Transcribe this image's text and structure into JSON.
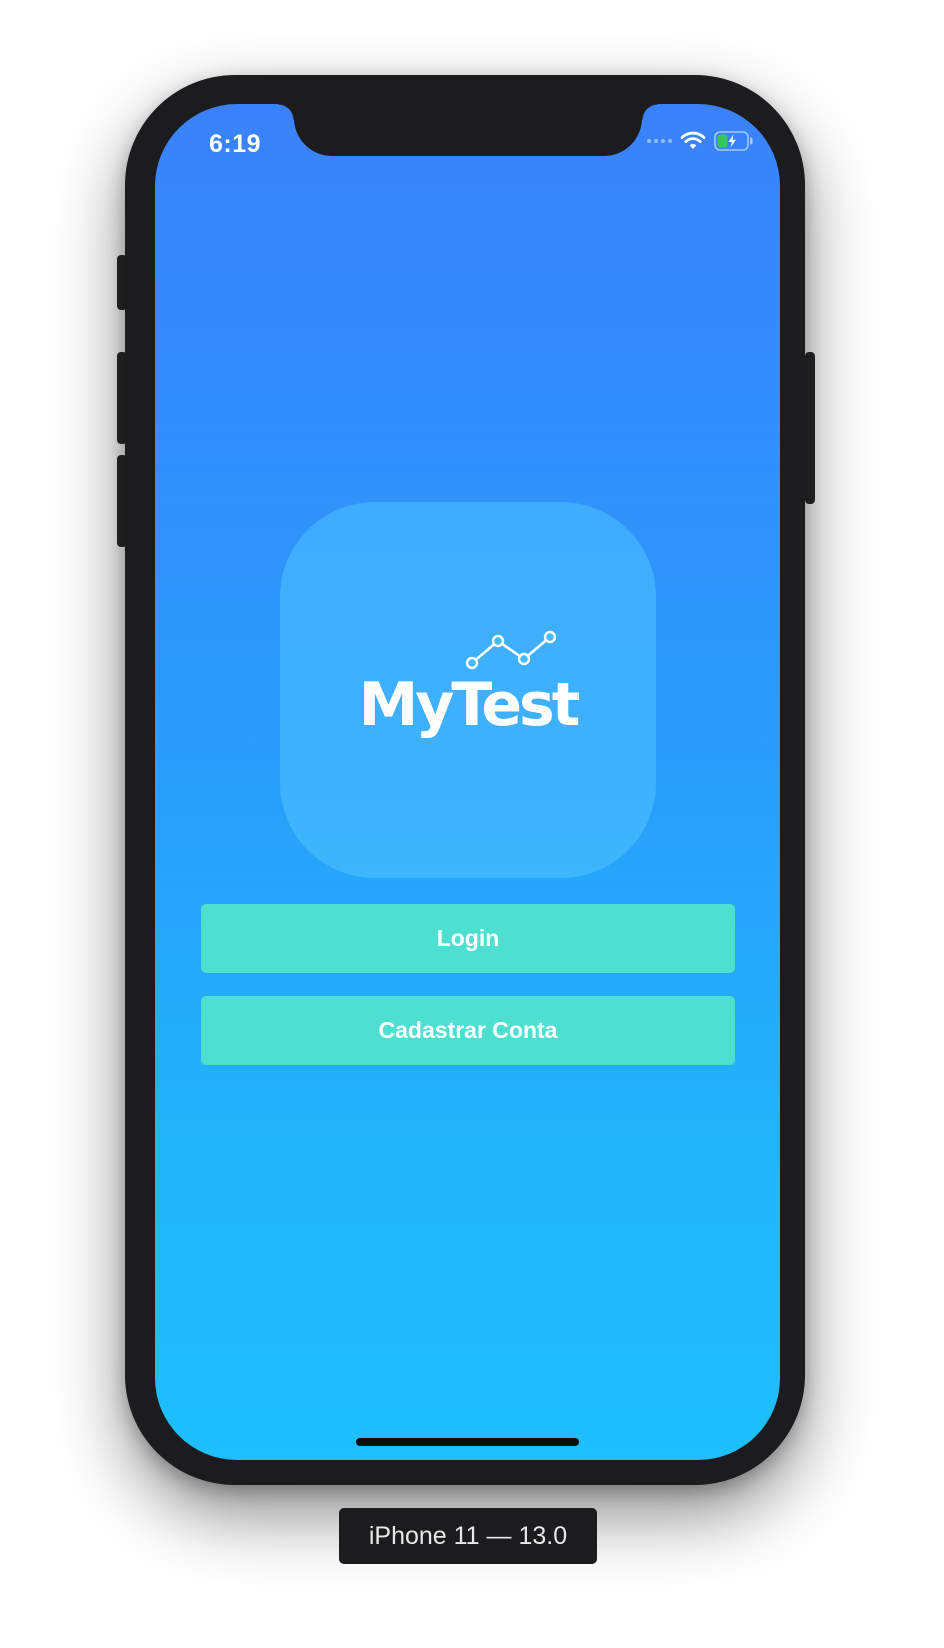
{
  "status_bar": {
    "time": "6:19",
    "icons": [
      "signal-icon",
      "wifi-icon",
      "battery-charging-icon"
    ]
  },
  "logo": {
    "text": "MyTest",
    "icon": "line-chart-icon"
  },
  "buttons": {
    "login_label": "Login",
    "register_label": "Cadastrar Conta"
  },
  "simulator": {
    "device_label": "iPhone 11 — 13.0"
  },
  "colors": {
    "gradient_top": "#3a82fb",
    "gradient_bottom": "#1ebffc",
    "button": "#4de0d1",
    "battery_fill": "#34c759"
  }
}
